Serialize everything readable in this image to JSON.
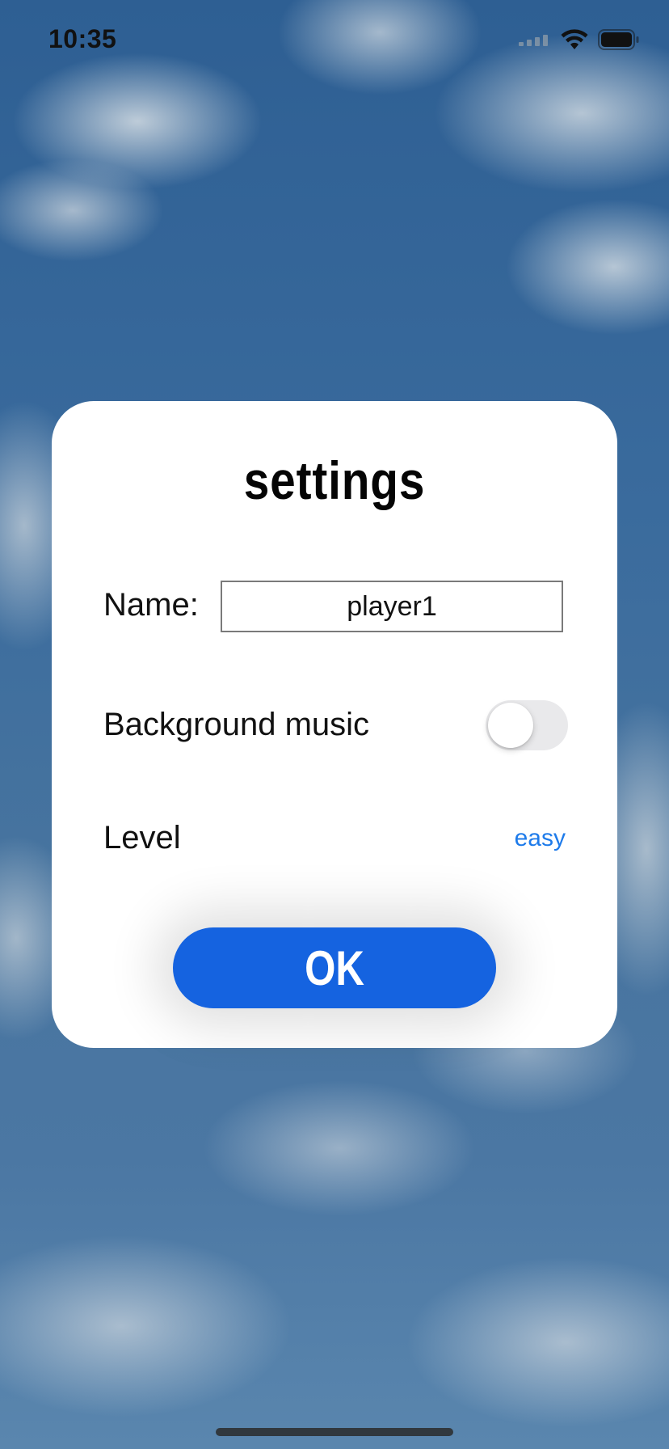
{
  "status_bar": {
    "time": "10:35",
    "icons": [
      "cellular-signal-icon",
      "wifi-icon",
      "battery-icon"
    ]
  },
  "dialog": {
    "title": "settings",
    "name_label": "Name:",
    "name_value": "player1",
    "background_music_label": "Background music",
    "background_music_on": false,
    "level_label": "Level",
    "level_value": "easy",
    "ok_label": "OK"
  },
  "colors": {
    "accent": "#1563e0",
    "link": "#1e7bea",
    "toggle_off": "#e9e9eb",
    "sky": "#3a6b9d"
  }
}
